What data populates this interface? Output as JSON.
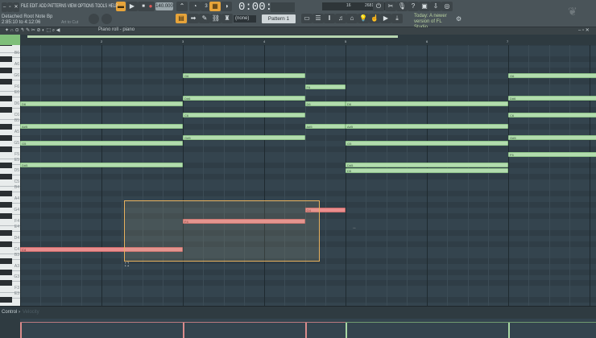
{
  "menu": [
    "FILE",
    "EDIT",
    "ADD",
    "PATTERNS",
    "VIEW",
    "OPTIONS",
    "TOOLS",
    "HELP"
  ],
  "hint": {
    "title": "Detached Root Note Bp",
    "range": "2:85:10 to 4:12:06",
    "art": "Art to Cut"
  },
  "tempo": "140.000",
  "time": "0:00:00",
  "cpu": {
    "cores": "16",
    "memory": "2681 MB",
    "poly": "0"
  },
  "pattern_select": "(none)",
  "pattern": "Pattern 1",
  "news": "Today: A newer version of FL Studio",
  "window_title": "Piano roll - piano",
  "bar_numbers": [
    "2",
    "3",
    "4",
    "5",
    "6",
    "7"
  ],
  "control": {
    "label": "Control ›",
    "lane": "Velocity"
  },
  "keys_labeled": [
    "B6",
    "A6",
    "G6",
    "F6",
    "E6",
    "D6",
    "C6",
    "B5",
    "A5",
    "G5",
    "F5",
    "E5",
    "D5",
    "C5",
    "B4",
    "A4",
    "G4",
    "F4",
    "E4",
    "D4",
    "C4",
    "B3",
    "A3",
    "G3",
    "F3",
    "E3"
  ],
  "notes": [
    {
      "name": "D6",
      "midi": 86,
      "start": 1,
      "end": 3
    },
    {
      "name": "A#5",
      "midi": 82,
      "start": 1,
      "end": 3
    },
    {
      "name": "G5",
      "midi": 79,
      "start": 1,
      "end": 3
    },
    {
      "name": "D#5",
      "midi": 75,
      "start": 1,
      "end": 3
    },
    {
      "name": "C4",
      "midi": 60,
      "start": 1,
      "end": 3,
      "sel": true
    },
    {
      "name": "G6",
      "midi": 91,
      "start": 3,
      "end": 4.5
    },
    {
      "name": "D#6",
      "midi": 87,
      "start": 3,
      "end": 4.5
    },
    {
      "name": "C6",
      "midi": 84,
      "start": 3,
      "end": 4.5
    },
    {
      "name": "G#5",
      "midi": 80,
      "start": 3,
      "end": 4.5
    },
    {
      "name": "F4",
      "midi": 65,
      "start": 3,
      "end": 4.5,
      "sel": true
    },
    {
      "name": "F6",
      "midi": 89,
      "start": 4.5,
      "end": 5
    },
    {
      "name": "D6",
      "midi": 86,
      "start": 4.5,
      "end": 5
    },
    {
      "name": "A#5",
      "midi": 82,
      "start": 4.5,
      "end": 5
    },
    {
      "name": "G4",
      "midi": 67,
      "start": 4.5,
      "end": 5,
      "sel": true
    },
    {
      "name": "D6",
      "midi": 86,
      "start": 5,
      "end": 7
    },
    {
      "name": "A#5",
      "midi": 82,
      "start": 5,
      "end": 7
    },
    {
      "name": "G5",
      "midi": 79,
      "start": 5,
      "end": 7
    },
    {
      "name": "D#5",
      "midi": 75,
      "start": 5,
      "end": 7
    },
    {
      "name": "D5",
      "midi": 74,
      "start": 5,
      "end": 7
    },
    {
      "name": "G6",
      "midi": 91,
      "start": 7,
      "end": 8.1
    },
    {
      "name": "D#6",
      "midi": 87,
      "start": 7,
      "end": 8.1
    },
    {
      "name": "C6",
      "midi": 84,
      "start": 7,
      "end": 8.1
    },
    {
      "name": "G#5",
      "midi": 80,
      "start": 7,
      "end": 8.1
    },
    {
      "name": "F5",
      "midi": 77,
      "start": 7,
      "end": 8.1
    }
  ],
  "colors": {
    "note": "#b2dcae",
    "selected_note": "#ea8e8e",
    "selection": "#e8b15e",
    "accent": "#e7a43a"
  }
}
